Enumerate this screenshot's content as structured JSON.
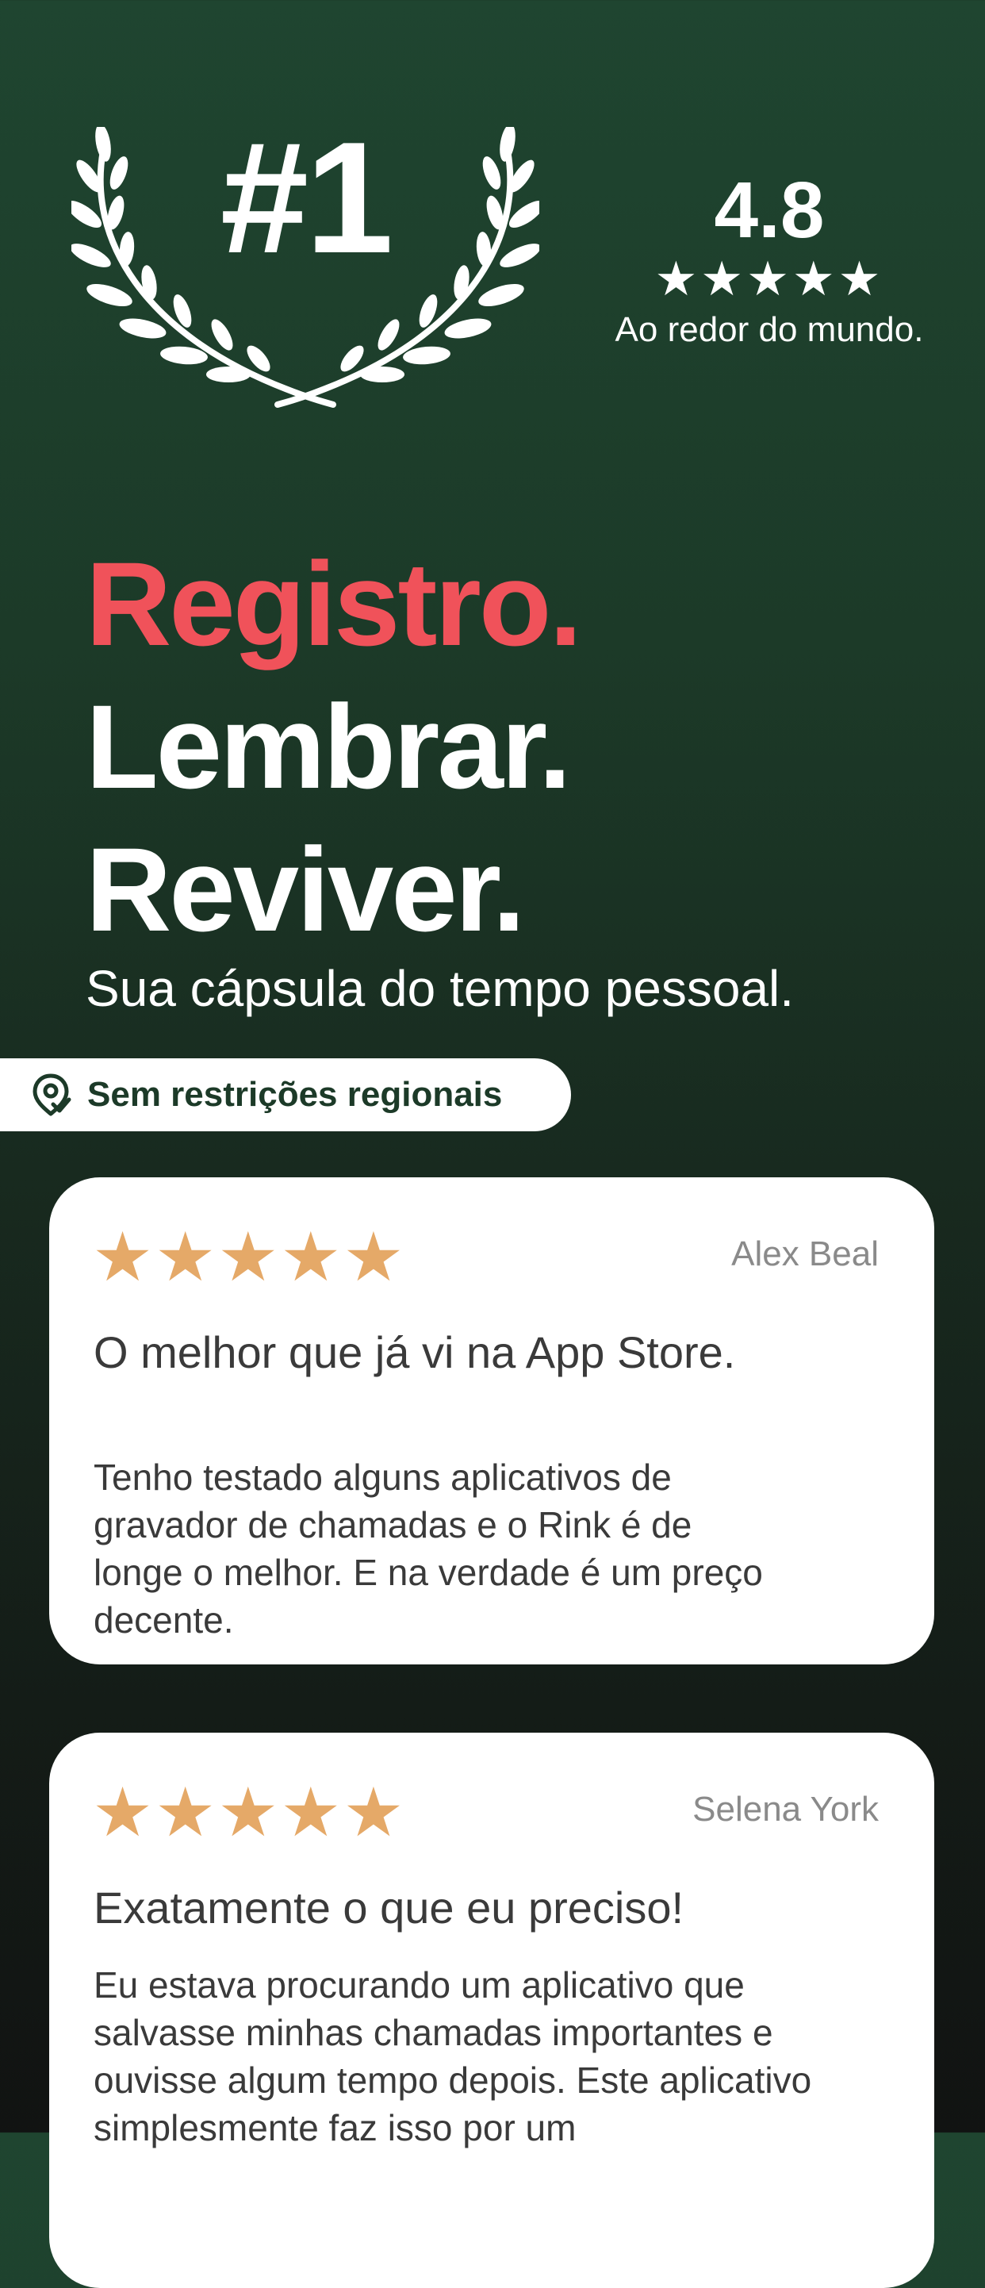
{
  "header": {
    "rank": "#1",
    "rating": "4.8",
    "rating_stars": "★★★★★",
    "rating_caption": "Ao redor do mundo."
  },
  "hero": {
    "line1": "Registro.",
    "line2": "Lembrar.",
    "line3": "Reviver.",
    "tagline": "Sua cápsula do tempo pessoal."
  },
  "badge": {
    "label": "Sem restrições regionais",
    "icon": "location-pin-icon"
  },
  "reviews": [
    {
      "stars": "★★★★★",
      "author": "Alex Beal",
      "title": "O melhor que já vi na App Store.",
      "body": "Tenho testado alguns aplicativos de gravador de chamadas e o Rink é de longe o melhor. E na verdade é um preço decente."
    },
    {
      "stars": "★★★★★",
      "author": "Selena York",
      "title": "Exatamente o que eu preciso!",
      "body": "Eu estava procurando um aplicativo que salvasse minhas chamadas importantes e ouvisse algum tempo depois. Este aplicativo simplesmente faz isso por um"
    }
  ],
  "colors": {
    "accent_red": "#f0525a",
    "star_gold": "#e5a968",
    "background_green": "#1f4530"
  }
}
